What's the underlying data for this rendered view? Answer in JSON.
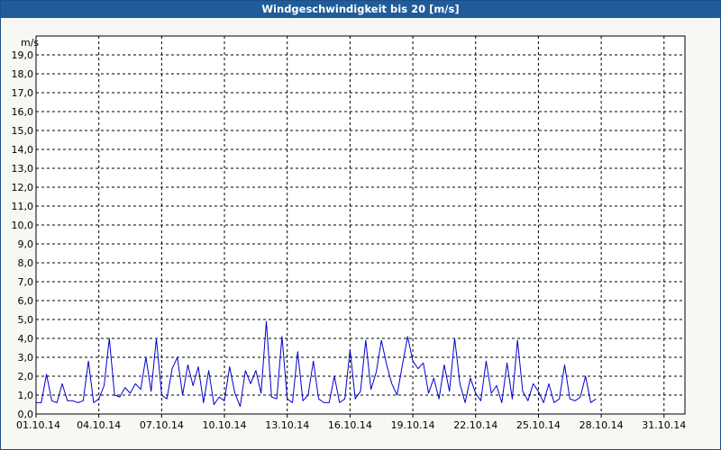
{
  "window": {
    "title": "Windgeschwindigkeit bis 20 [m/s]"
  },
  "colors": {
    "titlebar": "#1f5c99",
    "series": "#0000cc",
    "grid": "#000000",
    "background": "#ffffff"
  },
  "chart_data": {
    "type": "line",
    "title": "Windgeschwindigkeit bis 20 [m/s]",
    "ylabel": "m/s",
    "xlabel": "",
    "ylim": [
      0,
      20
    ],
    "xlim": [
      "01.10.14",
      "01.11.14"
    ],
    "grid": true,
    "yticks": [
      "0,0",
      "1,0",
      "2,0",
      "3,0",
      "4,0",
      "5,0",
      "6,0",
      "7,0",
      "8,0",
      "9,0",
      "10,0",
      "11,0",
      "12,0",
      "13,0",
      "14,0",
      "15,0",
      "16,0",
      "17,0",
      "18,0",
      "19,0"
    ],
    "xticks": [
      "01.10.14",
      "04.10.14",
      "07.10.14",
      "10.10.14",
      "13.10.14",
      "16.10.14",
      "19.10.14",
      "22.10.14",
      "25.10.14",
      "28.10.14",
      "31.10.14"
    ],
    "series": [
      {
        "values_start": "01.10.14",
        "sample_interval_hours": 6,
        "values": [
          0.6,
          0.6,
          2.1,
          0.7,
          0.6,
          1.6,
          0.7,
          0.7,
          0.6,
          0.7,
          2.8,
          0.6,
          0.8,
          1.5,
          4.0,
          1.0,
          0.9,
          1.4,
          1.1,
          1.6,
          1.3,
          3.0,
          1.2,
          4.0,
          1.0,
          0.8,
          2.4,
          3.0,
          1.0,
          2.6,
          1.5,
          2.5,
          0.6,
          2.3,
          0.5,
          0.9,
          0.7,
          2.5,
          1.1,
          0.4,
          2.3,
          1.6,
          2.3,
          1.1,
          4.9,
          0.9,
          0.8,
          4.1,
          0.8,
          0.6,
          3.3,
          0.7,
          1.0,
          2.8,
          0.8,
          0.6,
          0.6,
          2.0,
          0.6,
          0.8,
          3.4,
          0.8,
          1.2,
          3.9,
          1.3,
          2.2,
          3.9,
          2.6,
          1.6,
          1.0,
          2.6,
          4.1,
          2.8,
          2.4,
          2.7,
          1.1,
          1.9,
          0.8,
          2.6,
          1.2,
          4.0,
          1.6,
          0.6,
          1.9,
          1.1,
          0.7,
          2.8,
          1.1,
          1.5,
          0.6,
          2.7,
          0.8,
          3.9,
          1.2,
          0.7,
          1.6,
          1.2,
          0.6,
          1.6,
          0.6,
          0.8,
          2.6,
          0.8,
          0.7,
          0.9,
          2.0,
          0.6,
          0.8
        ]
      }
    ]
  }
}
